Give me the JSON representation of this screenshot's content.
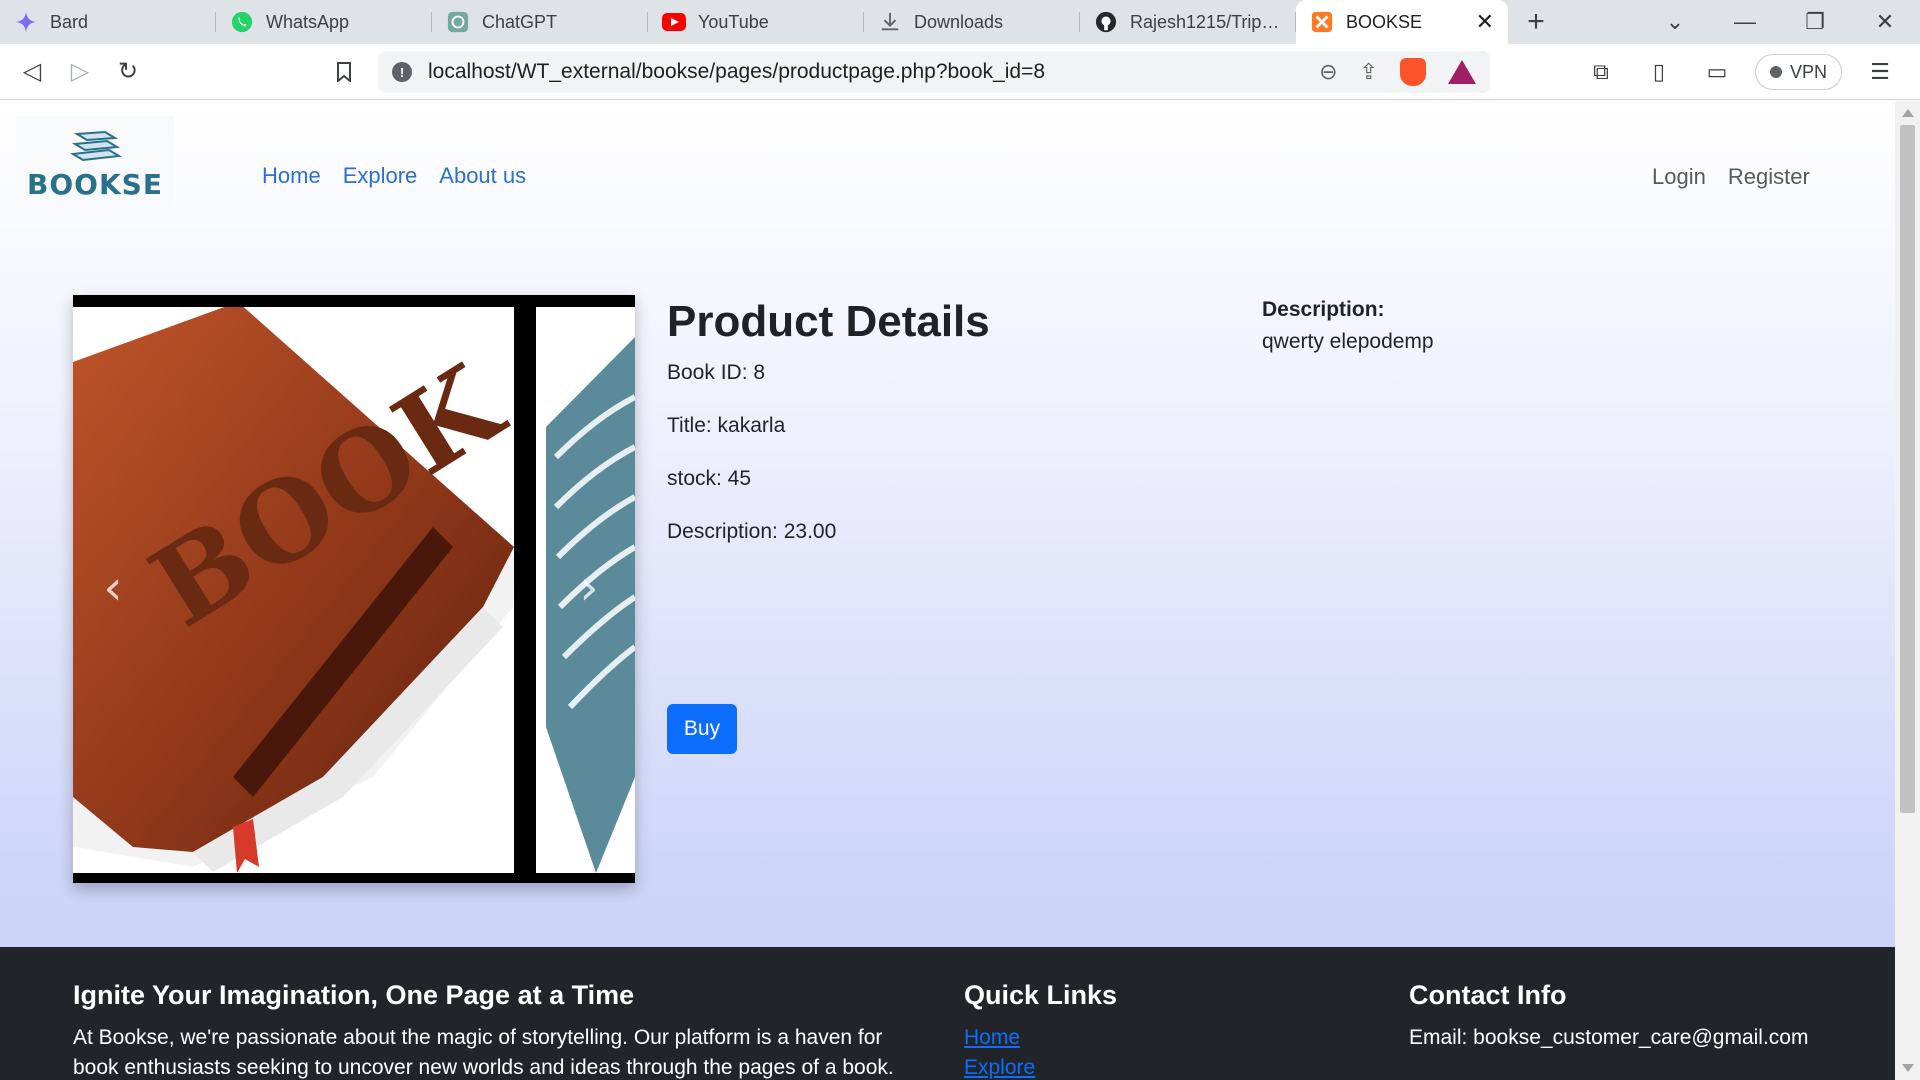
{
  "browser": {
    "tabs": [
      {
        "label": "Bard",
        "icon": "bard-sparkle-icon"
      },
      {
        "label": "WhatsApp",
        "icon": "whatsapp-icon"
      },
      {
        "label": "ChatGPT",
        "icon": "chatgpt-icon"
      },
      {
        "label": "YouTube",
        "icon": "youtube-icon"
      },
      {
        "label": "Downloads",
        "icon": "download-icon"
      },
      {
        "label": "Rajesh1215/Tripnest",
        "icon": "github-icon"
      },
      {
        "label": "BOOKSE",
        "icon": "xampp-icon",
        "active": true
      }
    ],
    "url": "localhost/WT_external/bookse/pages/productpage.php?book_id=8",
    "vpn_label": "VPN"
  },
  "site": {
    "brand": "BOOKSE",
    "nav": [
      "Home",
      "Explore",
      "About us"
    ],
    "auth": [
      "Login",
      "Register"
    ]
  },
  "product": {
    "heading": "Product Details",
    "book_id": "Book ID: 8",
    "title": "Title: kakarla",
    "stock": "stock: 45",
    "price_line": "Description: 23.00",
    "buy_label": "Buy",
    "description_heading": "Description:",
    "description_text": "qwerty elepodemp",
    "image_text": "BOOK"
  },
  "footer": {
    "about_heading": "Ignite Your Imagination, One Page at a Time",
    "about_text": "At Bookse, we're passionate about the magic of storytelling. Our platform is a haven for book enthusiasts seeking to uncover new worlds and ideas through the pages of a book.",
    "links_heading": "Quick Links",
    "links": [
      "Home",
      "Explore"
    ],
    "contact_heading": "Contact Info",
    "contact_email": "Email: bookse_customer_care@gmail.com"
  },
  "colors": {
    "primary": "#0d6efd",
    "footer_bg": "#212529",
    "brand": "#2a6f8c"
  }
}
